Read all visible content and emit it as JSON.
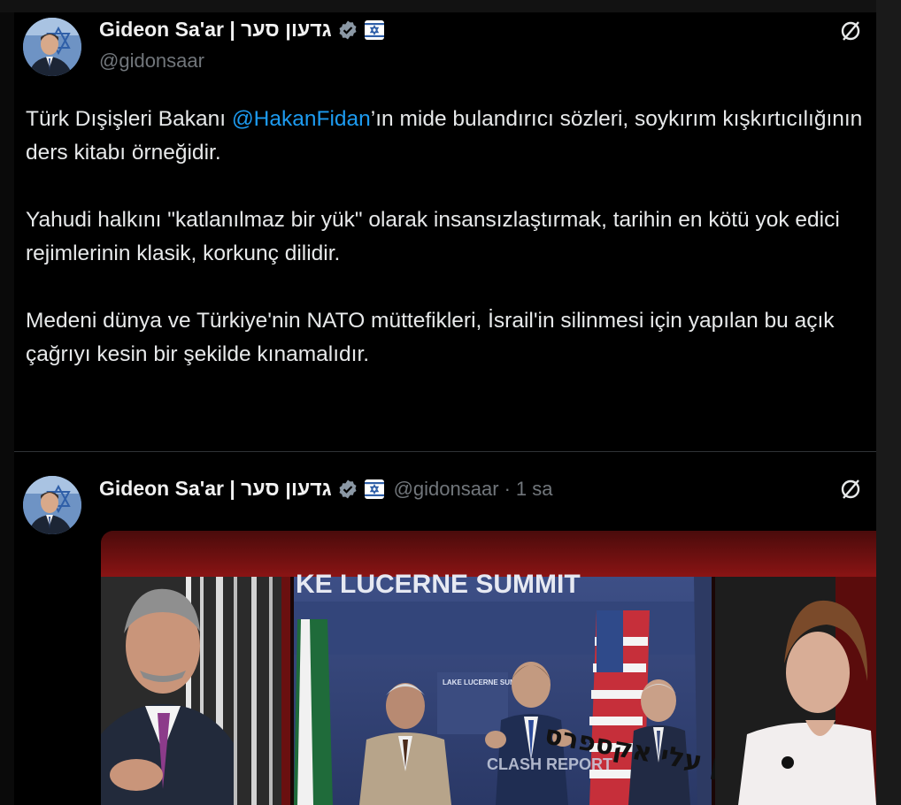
{
  "main_tweet": {
    "display_name": "Gideon Sa'ar | גדעון סער",
    "handle": "@gidonsaar",
    "text_before_mention": "Türk Dışişleri Bakanı ",
    "mention": "@HakanFidan",
    "text_after_mention": "’ın mide bulandırıcı sözleri, soykırım kışkırtıcılığının ders kitabı örneğidir.",
    "paragraph2": "Yahudi halkını \"katlanılmaz bir yük\" olarak insansızlaştırmak, tarihin en kötü yok edici rejimlerinin klasik, korkunç dilidir.",
    "paragraph3": "Medeni dünya ve Türkiye'nin NATO müttefikleri, İsrail'in silinmesi için yapılan bu açık çağrıyı kesin bir şekilde kınamalıdır."
  },
  "quoted_tweet": {
    "display_name": "Gideon Sa'ar | גדעון סער",
    "handle": "@gidonsaar",
    "separator": "·",
    "time": "1 sa",
    "media": {
      "banner_text": "KE LUCERNE SUMMIT",
      "podium_text": "LAKE LUCERNE SUMMIT",
      "watermark": "CLASH REPORT",
      "hebrew_caption": "כן עלי אקספרס"
    }
  },
  "icons": {
    "verified": "verified-badge-icon",
    "affiliation": "israel-flag-icon",
    "grok": "grok-icon"
  },
  "colors": {
    "background": "#000000",
    "text": "#e7e9ea",
    "mention": "#1d9bf0",
    "secondary": "#71767b",
    "verified": "#8b98a5"
  }
}
